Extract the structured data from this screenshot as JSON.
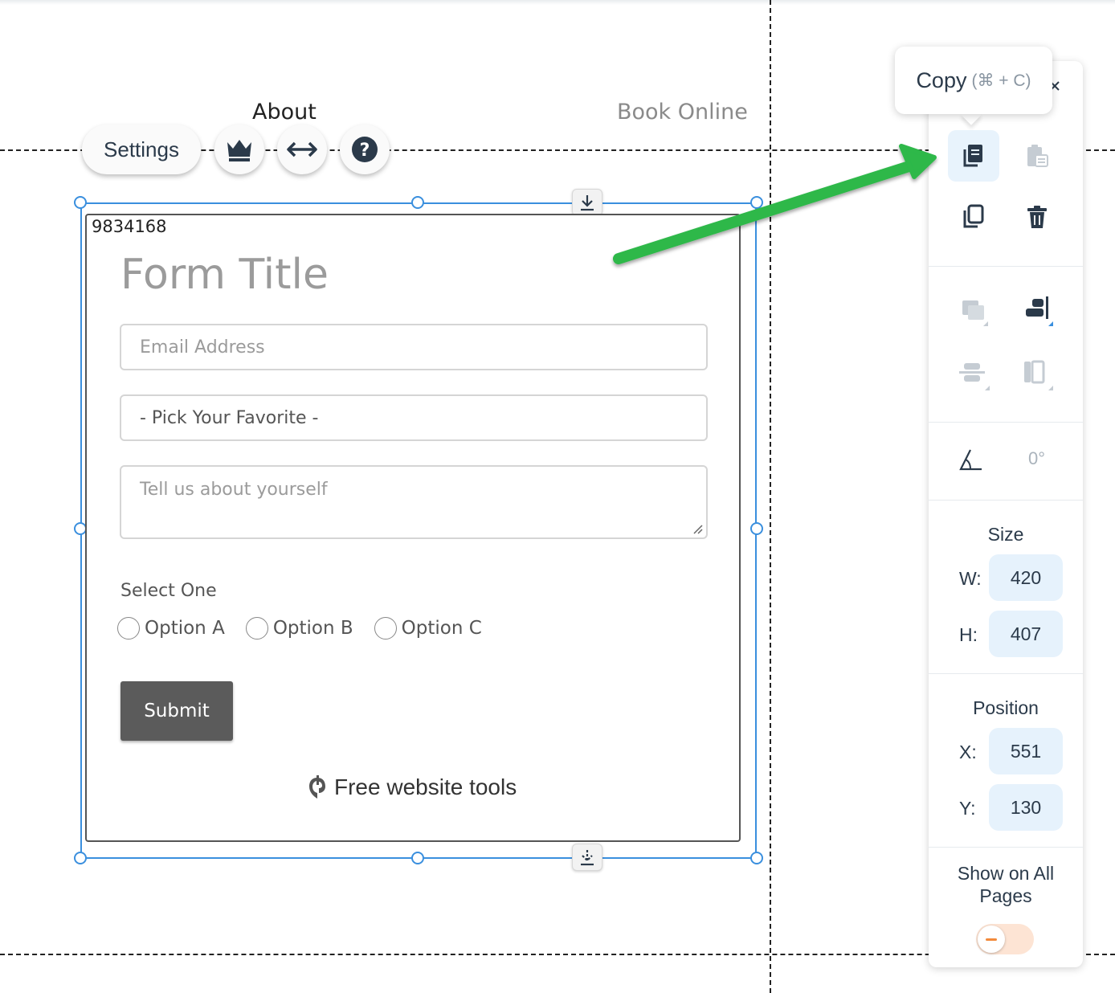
{
  "nav": {
    "about": "About",
    "book_online": "Book Online"
  },
  "toolbar": {
    "settings_label": "Settings"
  },
  "widget": {
    "id_label": "9834168",
    "form_title": "Form Title",
    "email_placeholder": "Email Address",
    "select_value": "- Pick Your Favorite -",
    "textarea_placeholder": "Tell us about yourself",
    "radio_group_label": "Select One",
    "radio_options": [
      "Option A",
      "Option B",
      "Option C"
    ],
    "submit_label": "Submit",
    "footer_text": "Free website tools"
  },
  "tooltip": {
    "label": "Copy",
    "shortcut": "(⌘ + C)"
  },
  "panel": {
    "size_label": "Size",
    "width_label": "W:",
    "width_value": "420",
    "height_label": "H:",
    "height_value": "407",
    "position_label": "Position",
    "x_label": "X:",
    "x_value": "551",
    "y_label": "Y:",
    "y_value": "130",
    "rotation_value": "0°",
    "show_all_pages_line1": "Show on All",
    "show_all_pages_line2": "Pages",
    "show_all_pages_on": false
  },
  "colors": {
    "selection": "#3a8fde",
    "arrow": "#2db84a",
    "panel_text": "#2b3a4a",
    "toggle_off": "#f28a3c"
  }
}
